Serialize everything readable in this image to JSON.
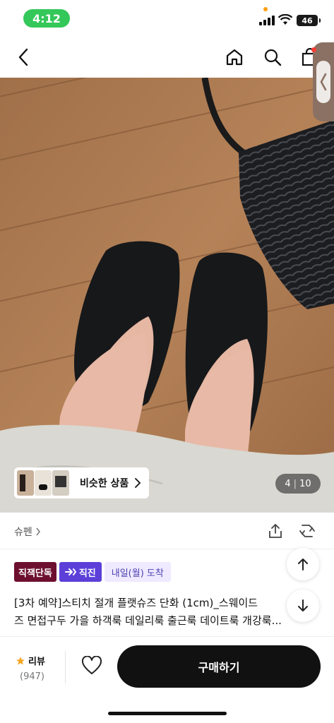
{
  "status_bar": {
    "time": "4:12",
    "battery": "46"
  },
  "nav": {
    "back_icon": "chevron-left-icon",
    "home_icon": "home-icon",
    "search_icon": "search-icon",
    "cart_icon": "shopping-bag-icon"
  },
  "gallery": {
    "similar_label": "비슷한 상품",
    "page_current": "4",
    "page_total": "10"
  },
  "brand": {
    "name": "슈펜"
  },
  "badges": {
    "exclusive": "직잭단독",
    "direct": "직진",
    "delivery": "내일(월) 도착"
  },
  "product": {
    "title_line1": "[3차 예약]스티치 절개 플랫슈즈 단화 (1cm)_스웨이드",
    "title_line2": "즈 면접구두 가을 하객룩 데일리룩 출근룩 데이트룩 개강룩..."
  },
  "bottom": {
    "review_label": "리뷰",
    "review_count": "(947)",
    "buy_label": "구매하기"
  },
  "colors": {
    "accent_purple": "#5b3fd8",
    "exclusive_red": "#6d0f2e",
    "status_green": "#34c759"
  }
}
